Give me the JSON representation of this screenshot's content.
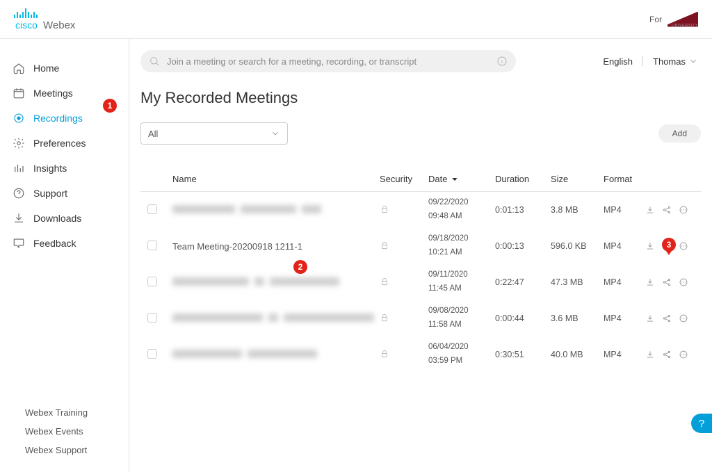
{
  "header": {
    "cisco": "cisco",
    "webex": "Webex",
    "for_label": "For"
  },
  "topright": {
    "language": "English",
    "user": "Thomas"
  },
  "search": {
    "placeholder": "Join a meeting or search for a meeting, recording, or transcript"
  },
  "sidebar": {
    "items": [
      "Home",
      "Meetings",
      "Recordings",
      "Preferences",
      "Insights",
      "Support",
      "Downloads",
      "Feedback"
    ],
    "active_index": 2,
    "bottom_links": [
      "Webex Training",
      "Webex Events",
      "Webex Support"
    ]
  },
  "page": {
    "title": "My Recorded Meetings",
    "filter_value": "All",
    "add_label": "Add"
  },
  "table": {
    "headers": {
      "name": "Name",
      "security": "Security",
      "date": "Date",
      "duration": "Duration",
      "size": "Size",
      "format": "Format"
    },
    "rows": [
      {
        "name_visible": false,
        "date": "09/22/2020",
        "time": "09:48 AM",
        "duration": "0:01:13",
        "size": "3.8 MB",
        "format": "MP4"
      },
      {
        "name_visible": true,
        "name": "Team Meeting-20200918 1211-1",
        "date": "09/18/2020",
        "time": "10:21 AM",
        "duration": "0:00:13",
        "size": "596.0 KB",
        "format": "MP4"
      },
      {
        "name_visible": false,
        "date": "09/11/2020",
        "time": "11:45 AM",
        "duration": "0:22:47",
        "size": "47.3 MB",
        "format": "MP4"
      },
      {
        "name_visible": false,
        "date": "09/08/2020",
        "time": "11:58 AM",
        "duration": "0:00:44",
        "size": "3.6 MB",
        "format": "MP4"
      },
      {
        "name_visible": false,
        "date": "06/04/2020",
        "time": "03:59 PM",
        "duration": "0:30:51",
        "size": "40.0 MB",
        "format": "MP4"
      }
    ]
  },
  "annotations": {
    "badges": [
      "1",
      "2",
      "3"
    ]
  },
  "help_fab": "?"
}
